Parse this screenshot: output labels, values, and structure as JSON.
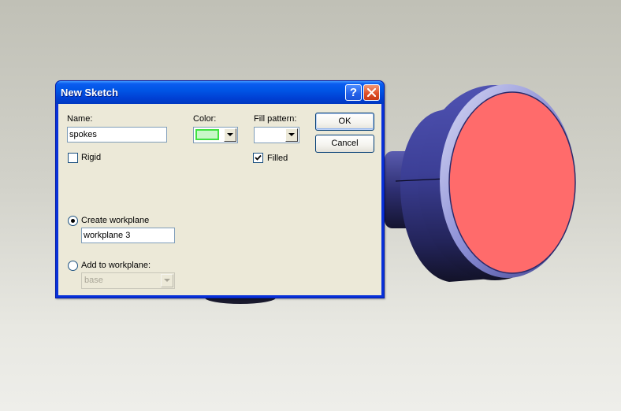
{
  "dialog": {
    "title": "New Sketch",
    "help_glyph": "?",
    "name_label": "Name:",
    "name_value": "spokes",
    "color_label": "Color:",
    "color_value": "#c8f7c8",
    "color_border": "#3fe23f",
    "fill_pattern_label": "Fill pattern:",
    "rigid_label": "Rigid",
    "rigid_checked": false,
    "filled_label": "Filled",
    "filled_checked": true,
    "ok_label": "OK",
    "cancel_label": "Cancel",
    "create_workplane_label": "Create workplane",
    "create_workplane_selected": true,
    "workplane_name_value": "workplane 3",
    "add_to_workplane_label": "Add to workplane:",
    "add_to_workplane_selected": false,
    "workplane_select_value": "base"
  },
  "model": {
    "body_color": "#3a3d8c",
    "face_color": "#ff6b6b"
  }
}
